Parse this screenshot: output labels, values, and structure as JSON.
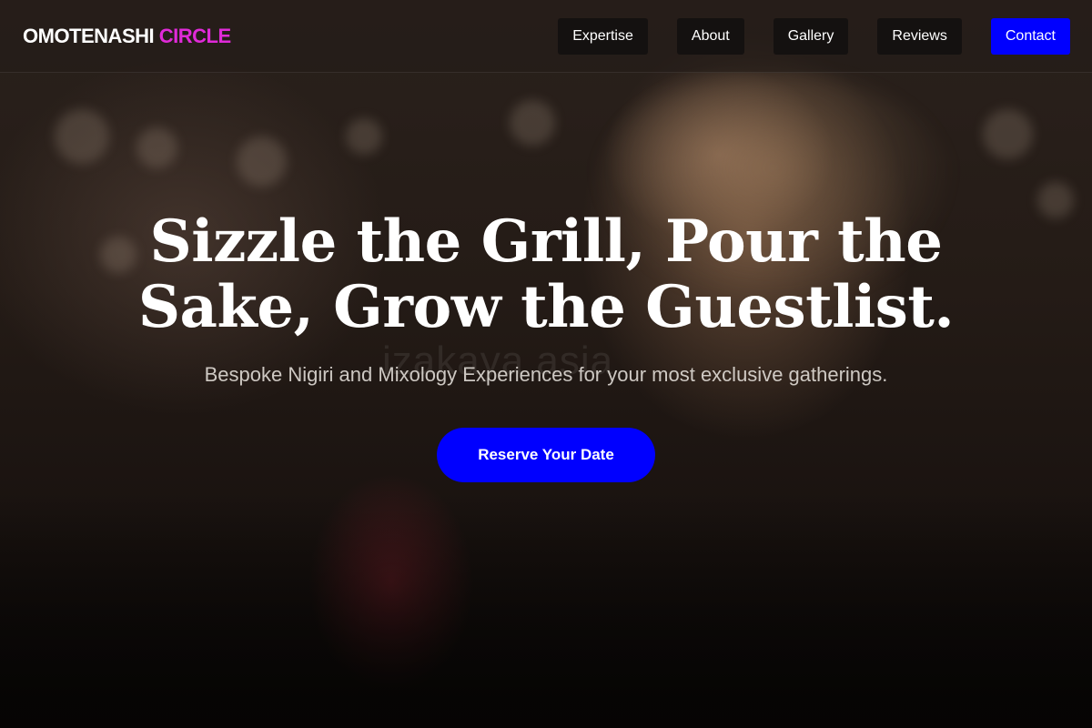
{
  "brand": {
    "name_part1": "OMOTENASHI",
    "name_part2": "CIRCLE",
    "accent_color": "#e02ad8"
  },
  "nav": {
    "items": [
      {
        "label": "Expertise"
      },
      {
        "label": "About"
      },
      {
        "label": "Gallery"
      },
      {
        "label": "Reviews"
      },
      {
        "label": "Contact"
      }
    ],
    "contact_color": "#0000ff"
  },
  "hero": {
    "headline": "Sizzle the Grill, Pour the Sake, Grow the Guestlist.",
    "subtitle": "Bespoke Nigiri and Mixology Experiences for your most exclusive gatherings.",
    "cta_label": "Reserve Your Date",
    "cta_color": "#0000ff",
    "background_watermark": "izakaya asia"
  }
}
